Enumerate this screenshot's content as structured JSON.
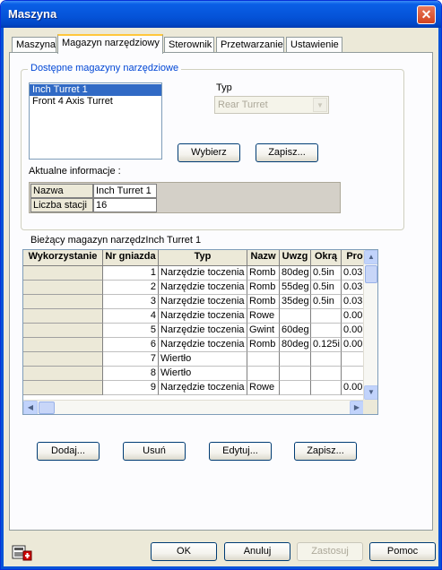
{
  "window": {
    "title": "Maszyna",
    "close_glyph": "✕"
  },
  "tabs": [
    {
      "label": "Maszyna",
      "active": false
    },
    {
      "label": "Magazyn narzędziowy",
      "active": true
    },
    {
      "label": "Sterownik",
      "active": false
    },
    {
      "label": "Przetwarzanie",
      "active": false
    },
    {
      "label": "Ustawienie",
      "active": false
    }
  ],
  "magazines": {
    "group_label": "Dostępne magazyny narzędziowe",
    "items": [
      "Inch Turret 1",
      "Front 4 Axis Turret"
    ],
    "selected": "Inch Turret 1",
    "type_label": "Typ",
    "type_value": "Rear Turret",
    "select_button": "Wybierz",
    "save_button": "Zapisz..."
  },
  "info": {
    "label": "Aktualne informacje :",
    "rows": [
      {
        "name": "Nazwa",
        "value": "Inch Turret 1"
      },
      {
        "name": "Liczba stacji",
        "value": "16"
      }
    ]
  },
  "current": {
    "label": "Bieżący magazyn narzędzInch Turret 1",
    "columns": [
      "Wykorzystanie",
      "Nr gniazda",
      "Typ",
      "Nazw",
      "Uwzg",
      "Okrą",
      "Pro"
    ],
    "rows": [
      [
        "",
        "1",
        "Narzędzie toczenia",
        "Romb",
        "80deg",
        "0.5in",
        "0.03"
      ],
      [
        "",
        "2",
        "Narzędzie toczenia",
        "Romb",
        "55deg",
        "0.5in",
        "0.03"
      ],
      [
        "",
        "3",
        "Narzędzie toczenia",
        "Romb",
        "35deg",
        "0.5in",
        "0.03"
      ],
      [
        "",
        "4",
        "Narzędzie toczenia",
        "Rowe",
        "",
        "",
        "0.00"
      ],
      [
        "",
        "5",
        "Narzędzie toczenia",
        "Gwint",
        "60deg",
        "",
        "0.00"
      ],
      [
        "",
        "6",
        "Narzędzie toczenia",
        "Romb",
        "80deg",
        "0.125i",
        "0.00"
      ],
      [
        "",
        "7",
        "Wiertło",
        "",
        "",
        "",
        ""
      ],
      [
        "",
        "8",
        "Wiertło",
        "",
        "",
        "",
        ""
      ],
      [
        "",
        "9",
        "Narzędzie toczenia",
        "Rowe",
        "",
        "",
        "0.00"
      ]
    ]
  },
  "actions": {
    "add": "Dodaj...",
    "remove": "Usuń",
    "edit": "Edytuj...",
    "save": "Zapisz..."
  },
  "footer": {
    "ok": "OK",
    "cancel": "Anuluj",
    "apply": "Zastosuj",
    "help": "Pomoc"
  },
  "colors": {
    "title_bar": "#0553d8",
    "selection": "#316ac5",
    "tab_highlight": "#ffc73c",
    "group_label": "#0046d5"
  },
  "icons": {
    "close": "close-icon",
    "app": "machine-icon",
    "scroll_up": "arrow-up-icon",
    "scroll_down": "arrow-down-icon",
    "scroll_left": "arrow-left-icon",
    "scroll_right": "arrow-right-icon",
    "combo": "chevron-down-icon"
  }
}
